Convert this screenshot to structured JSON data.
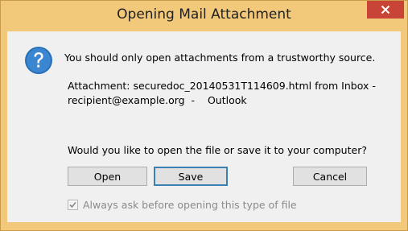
{
  "window": {
    "title": "Opening Mail Attachment",
    "close_label": "×"
  },
  "dialog": {
    "icon": "question-icon",
    "message": "You should only open attachments from a trustworthy source.",
    "attachment_line1": "Attachment: securedoc_20140531T114609.html from Inbox -",
    "attachment_line2": "recipient@example.org  -    Outlook",
    "question": "Would you like to open the file or save it to your computer?"
  },
  "buttons": {
    "open": "Open",
    "save": "Save",
    "cancel": "Cancel"
  },
  "checkbox": {
    "label": "Always ask before opening this type of file",
    "checked": true,
    "enabled": false
  },
  "colors": {
    "frame": "#f2c87a",
    "close_button": "#c84436",
    "client_bg": "#f0f0f0",
    "default_button_border": "#3c7fb1",
    "disabled_text": "#8a8a8a"
  }
}
